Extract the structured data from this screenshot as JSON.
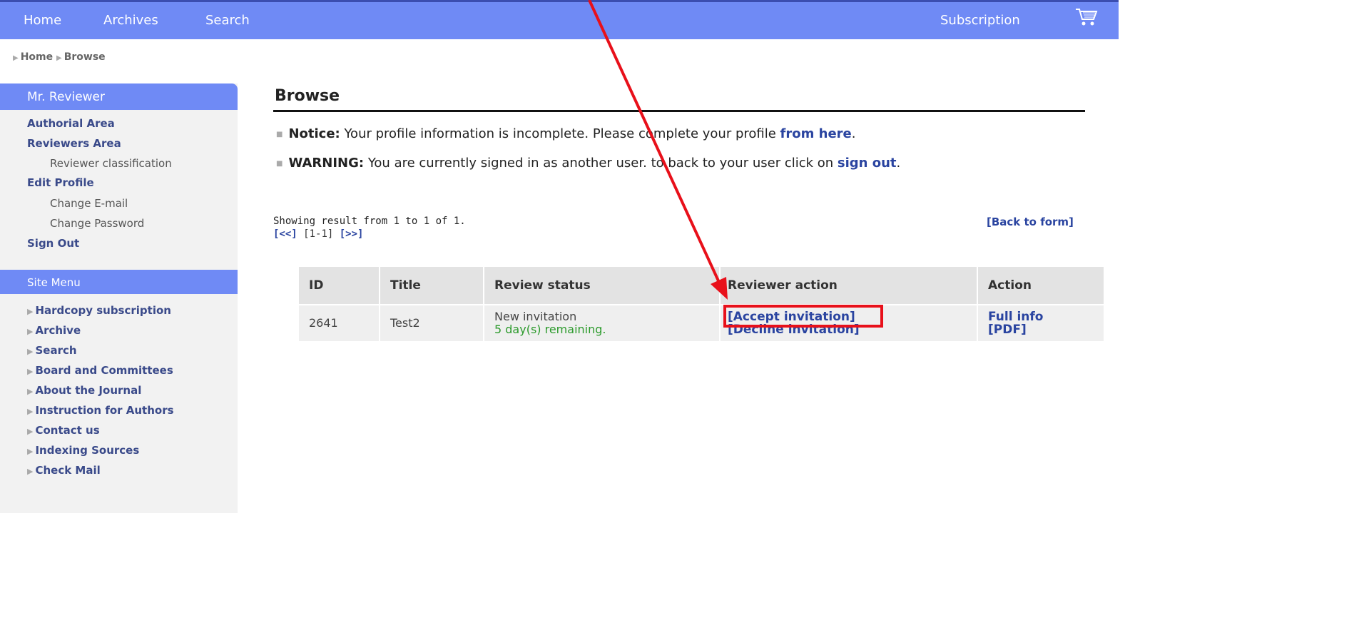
{
  "topnav": {
    "home": "Home",
    "archives": "Archives",
    "search": "Search",
    "subscription": "Subscription"
  },
  "breadcrumb": {
    "home": "Home",
    "browse": "Browse"
  },
  "sidebar": {
    "user_name": "Mr. Reviewer",
    "authorial_area": "Authorial Area",
    "reviewers_area": "Reviewers Area",
    "reviewer_classification": "Reviewer classification",
    "edit_profile": "Edit Profile",
    "change_email": "Change E-mail",
    "change_password": "Change Password",
    "sign_out": "Sign Out",
    "site_menu_title": "Site Menu",
    "site_menu": [
      "Hardcopy subscription",
      "Archive",
      "Search",
      "Board and Committees",
      "About the Journal",
      "Instruction for Authors",
      "Contact us",
      "Indexing Sources",
      "Check Mail"
    ]
  },
  "main": {
    "title": "Browse",
    "notice_label": "Notice:",
    "notice_text": " Your profile information is incomplete. Please complete your profile ",
    "notice_link": "from here",
    "notice_end": ".",
    "warning_label": "WARNING:",
    "warning_text": " You are currently signed in as another user. to back to your user click on ",
    "warning_link": "sign out",
    "warning_end": ".",
    "showing": "Showing result from 1 to 1 of 1.",
    "pager_prev": "[<<]",
    "pager_range": "[1-1]",
    "pager_next": "[>>]",
    "back_to_form": "[Back to form]"
  },
  "table": {
    "headers": [
      "ID",
      "Title",
      "Review status",
      "Reviewer action",
      "Action"
    ],
    "row": {
      "id": "2641",
      "title": "Test2",
      "status": "New invitation",
      "remaining": "5 day(s) remaining.",
      "accept": "[Accept invitation]",
      "decline": "[Decline invitation]",
      "full_info": "Full info",
      "pdf": "[PDF]"
    }
  },
  "icons": {
    "cart": "shopping-cart-icon"
  },
  "colors": {
    "nav_bg": "#6f8af5",
    "link": "#2a44a0",
    "highlight": "#e8101a",
    "status_green": "#2b9a2b"
  }
}
